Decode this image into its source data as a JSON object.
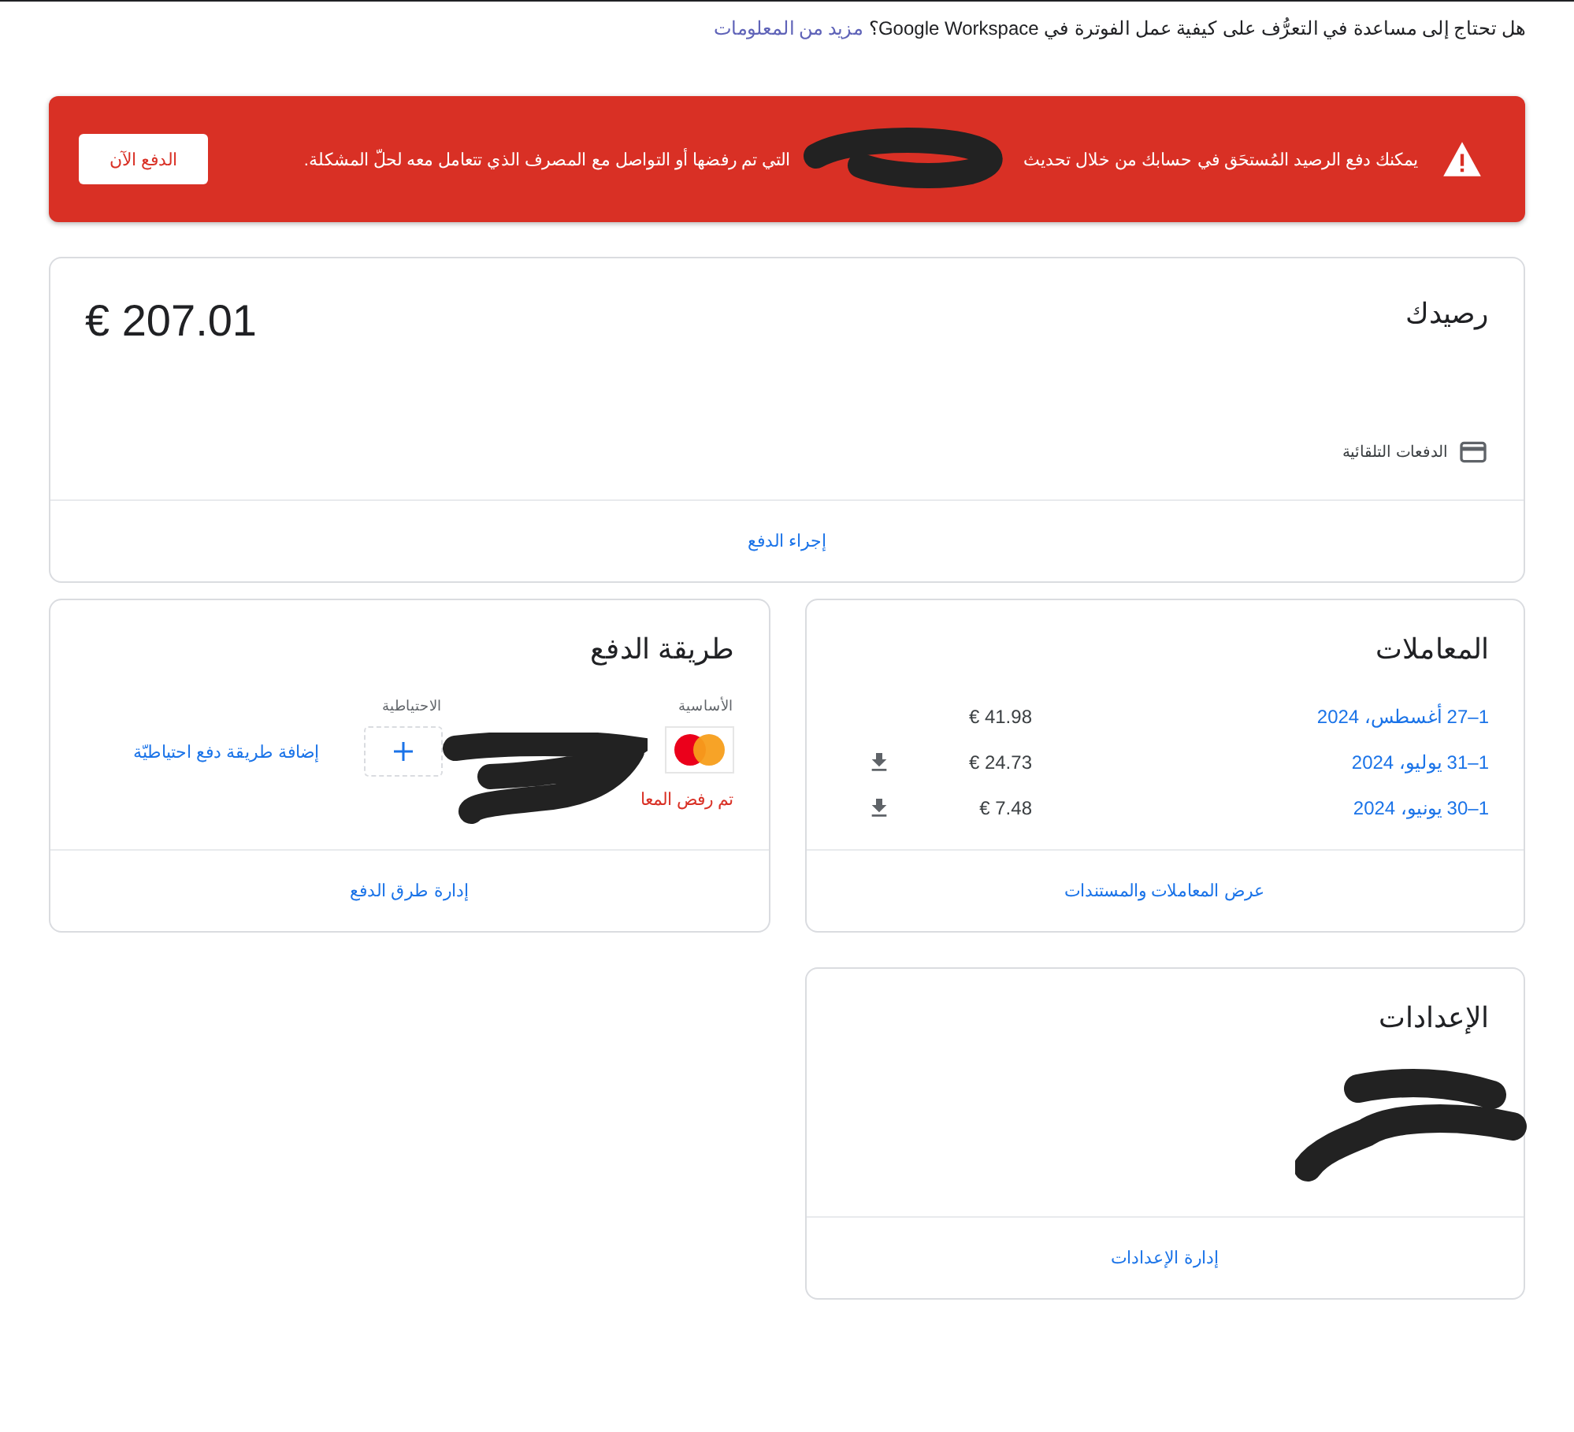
{
  "help_bar": {
    "question": "هل تحتاج إلى مساعدة في التعرُّف على كيفية عمل الفوترة في Google Workspace؟",
    "link": "مزيد من المعلومات"
  },
  "alert": {
    "text_start": "يمكنك دفع الرصيد المُستحَق في حسابك من خلال تحديث",
    "text_end": "التي تم رفضها أو التواصل مع المصرف الذي تتعامل معه لحلّ المشكلة.",
    "button": "الدفع الآن"
  },
  "balance": {
    "title": "رصيدك",
    "amount": "€ 207.01",
    "autopay": "الدفعات التلقائية",
    "action": "إجراء الدفع"
  },
  "transactions": {
    "title": "المعاملات",
    "rows": [
      {
        "period": "1–27 أغسطس، 2024",
        "amount": "€ 41.98",
        "download": false
      },
      {
        "period": "1–31 يوليو، 2024",
        "amount": "€ 24.73",
        "download": true
      },
      {
        "period": "1–30 يونيو، 2024",
        "amount": "€ 7.48",
        "download": true
      }
    ],
    "action": "عرض المعاملات والمستندات"
  },
  "payment_method": {
    "title": "طريقة الدفع",
    "primary_label": "الأساسية",
    "backup_label": "الاحتياطية",
    "declined": "تم رفض المعا",
    "add_backup": "إضافة طريقة دفع احتياطيّة",
    "action": "إدارة طرق الدفع"
  },
  "settings": {
    "title": "الإعدادات",
    "action": "إدارة الإعدادات"
  }
}
